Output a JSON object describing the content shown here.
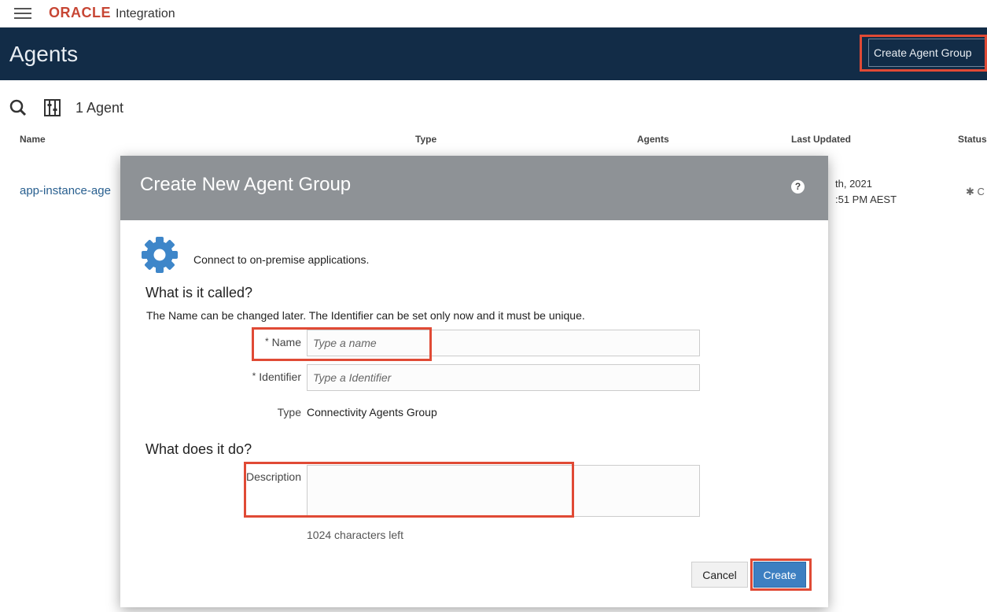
{
  "topbar": {
    "brand": "ORACLE",
    "product": "Integration"
  },
  "header": {
    "title": "Agents",
    "create_button": "Create Agent Group"
  },
  "toolbar": {
    "agent_count": "1 Agent"
  },
  "table": {
    "columns": [
      "Name",
      "Type",
      "Agents",
      "Last Updated",
      "Status"
    ],
    "row": {
      "name": "app-instance-age",
      "date_line1": "th, 2021",
      "date_line2": ":51 PM AEST",
      "status": "C"
    }
  },
  "dialog": {
    "title": "Create New Agent Group",
    "help": "?",
    "intro": "Connect to on-premise applications.",
    "section1": "What is it called?",
    "help_text": "The Name can be changed later. The Identifier can be set only now and it must be unique.",
    "name_label": "Name",
    "name_placeholder": "Type a name",
    "identifier_label": "Identifier",
    "identifier_placeholder": "Type a Identifier",
    "type_label": "Type",
    "type_value": "Connectivity Agents Group",
    "section2": "What does it do?",
    "description_label": "Description",
    "chars_left": "1024 characters left",
    "cancel": "Cancel",
    "create": "Create",
    "required_mark": "*"
  },
  "colors": {
    "header_bg": "#122c47",
    "dialog_header_bg": "#8e9296",
    "primary_button": "#3d7fc1",
    "highlight": "#e04a35"
  },
  "icons": [
    "menu-icon",
    "search-icon",
    "filter-icon",
    "gear-icon",
    "help-icon"
  ]
}
